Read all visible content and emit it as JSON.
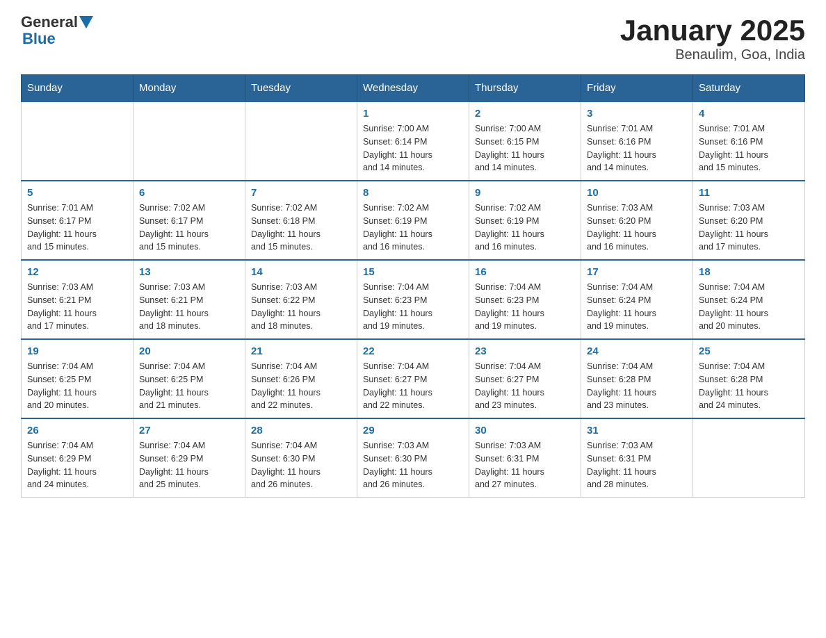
{
  "header": {
    "logo_general": "General",
    "logo_blue": "Blue",
    "title": "January 2025",
    "subtitle": "Benaulim, Goa, India"
  },
  "calendar": {
    "days_of_week": [
      "Sunday",
      "Monday",
      "Tuesday",
      "Wednesday",
      "Thursday",
      "Friday",
      "Saturday"
    ],
    "weeks": [
      [
        {
          "day": "",
          "info": ""
        },
        {
          "day": "",
          "info": ""
        },
        {
          "day": "",
          "info": ""
        },
        {
          "day": "1",
          "info": "Sunrise: 7:00 AM\nSunset: 6:14 PM\nDaylight: 11 hours\nand 14 minutes."
        },
        {
          "day": "2",
          "info": "Sunrise: 7:00 AM\nSunset: 6:15 PM\nDaylight: 11 hours\nand 14 minutes."
        },
        {
          "day": "3",
          "info": "Sunrise: 7:01 AM\nSunset: 6:16 PM\nDaylight: 11 hours\nand 14 minutes."
        },
        {
          "day": "4",
          "info": "Sunrise: 7:01 AM\nSunset: 6:16 PM\nDaylight: 11 hours\nand 15 minutes."
        }
      ],
      [
        {
          "day": "5",
          "info": "Sunrise: 7:01 AM\nSunset: 6:17 PM\nDaylight: 11 hours\nand 15 minutes."
        },
        {
          "day": "6",
          "info": "Sunrise: 7:02 AM\nSunset: 6:17 PM\nDaylight: 11 hours\nand 15 minutes."
        },
        {
          "day": "7",
          "info": "Sunrise: 7:02 AM\nSunset: 6:18 PM\nDaylight: 11 hours\nand 15 minutes."
        },
        {
          "day": "8",
          "info": "Sunrise: 7:02 AM\nSunset: 6:19 PM\nDaylight: 11 hours\nand 16 minutes."
        },
        {
          "day": "9",
          "info": "Sunrise: 7:02 AM\nSunset: 6:19 PM\nDaylight: 11 hours\nand 16 minutes."
        },
        {
          "day": "10",
          "info": "Sunrise: 7:03 AM\nSunset: 6:20 PM\nDaylight: 11 hours\nand 16 minutes."
        },
        {
          "day": "11",
          "info": "Sunrise: 7:03 AM\nSunset: 6:20 PM\nDaylight: 11 hours\nand 17 minutes."
        }
      ],
      [
        {
          "day": "12",
          "info": "Sunrise: 7:03 AM\nSunset: 6:21 PM\nDaylight: 11 hours\nand 17 minutes."
        },
        {
          "day": "13",
          "info": "Sunrise: 7:03 AM\nSunset: 6:21 PM\nDaylight: 11 hours\nand 18 minutes."
        },
        {
          "day": "14",
          "info": "Sunrise: 7:03 AM\nSunset: 6:22 PM\nDaylight: 11 hours\nand 18 minutes."
        },
        {
          "day": "15",
          "info": "Sunrise: 7:04 AM\nSunset: 6:23 PM\nDaylight: 11 hours\nand 19 minutes."
        },
        {
          "day": "16",
          "info": "Sunrise: 7:04 AM\nSunset: 6:23 PM\nDaylight: 11 hours\nand 19 minutes."
        },
        {
          "day": "17",
          "info": "Sunrise: 7:04 AM\nSunset: 6:24 PM\nDaylight: 11 hours\nand 19 minutes."
        },
        {
          "day": "18",
          "info": "Sunrise: 7:04 AM\nSunset: 6:24 PM\nDaylight: 11 hours\nand 20 minutes."
        }
      ],
      [
        {
          "day": "19",
          "info": "Sunrise: 7:04 AM\nSunset: 6:25 PM\nDaylight: 11 hours\nand 20 minutes."
        },
        {
          "day": "20",
          "info": "Sunrise: 7:04 AM\nSunset: 6:25 PM\nDaylight: 11 hours\nand 21 minutes."
        },
        {
          "day": "21",
          "info": "Sunrise: 7:04 AM\nSunset: 6:26 PM\nDaylight: 11 hours\nand 22 minutes."
        },
        {
          "day": "22",
          "info": "Sunrise: 7:04 AM\nSunset: 6:27 PM\nDaylight: 11 hours\nand 22 minutes."
        },
        {
          "day": "23",
          "info": "Sunrise: 7:04 AM\nSunset: 6:27 PM\nDaylight: 11 hours\nand 23 minutes."
        },
        {
          "day": "24",
          "info": "Sunrise: 7:04 AM\nSunset: 6:28 PM\nDaylight: 11 hours\nand 23 minutes."
        },
        {
          "day": "25",
          "info": "Sunrise: 7:04 AM\nSunset: 6:28 PM\nDaylight: 11 hours\nand 24 minutes."
        }
      ],
      [
        {
          "day": "26",
          "info": "Sunrise: 7:04 AM\nSunset: 6:29 PM\nDaylight: 11 hours\nand 24 minutes."
        },
        {
          "day": "27",
          "info": "Sunrise: 7:04 AM\nSunset: 6:29 PM\nDaylight: 11 hours\nand 25 minutes."
        },
        {
          "day": "28",
          "info": "Sunrise: 7:04 AM\nSunset: 6:30 PM\nDaylight: 11 hours\nand 26 minutes."
        },
        {
          "day": "29",
          "info": "Sunrise: 7:03 AM\nSunset: 6:30 PM\nDaylight: 11 hours\nand 26 minutes."
        },
        {
          "day": "30",
          "info": "Sunrise: 7:03 AM\nSunset: 6:31 PM\nDaylight: 11 hours\nand 27 minutes."
        },
        {
          "day": "31",
          "info": "Sunrise: 7:03 AM\nSunset: 6:31 PM\nDaylight: 11 hours\nand 28 minutes."
        },
        {
          "day": "",
          "info": ""
        }
      ]
    ]
  }
}
